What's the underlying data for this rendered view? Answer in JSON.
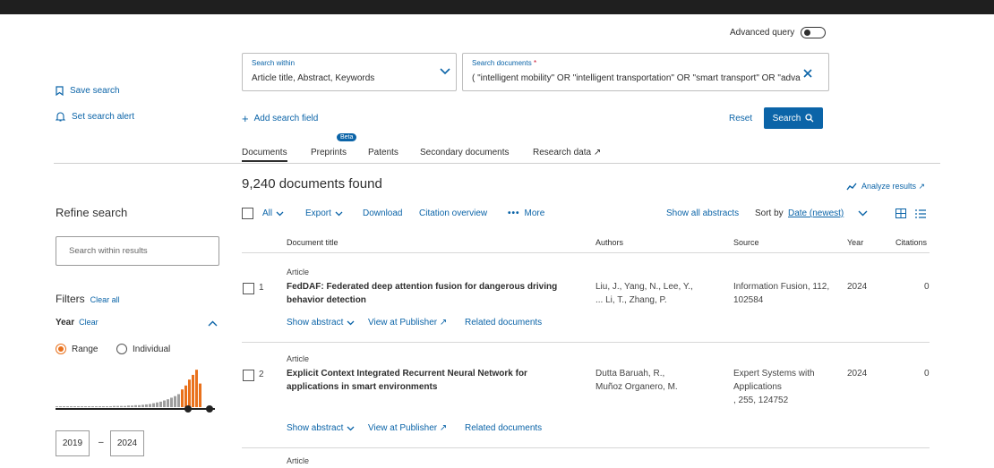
{
  "header": {
    "advanced_query_label": "Advanced query"
  },
  "search": {
    "within_label": "Search within",
    "within_value": "Article title, Abstract, Keywords",
    "docs_label": "Search documents",
    "docs_required": "*",
    "docs_value": "( \"intelligent mobility\" OR \"intelligent transportation\" OR \"smart transport\" OR \"adva",
    "add_field": "Add search field",
    "reset": "Reset",
    "search_button": "Search"
  },
  "left": {
    "save_search": "Save search",
    "set_alert": "Set search alert",
    "refine_title": "Refine search",
    "search_within_placeholder": "Search within results",
    "filters_label": "Filters",
    "clear_all": "Clear all",
    "year_label": "Year",
    "year_clear": "Clear",
    "range_label": "Range",
    "individual_label": "Individual",
    "year_from": "2019",
    "year_dash": "–",
    "year_to": "2024"
  },
  "tabs": [
    {
      "label": "Documents"
    },
    {
      "label": "Preprints"
    },
    {
      "label": "Patents"
    },
    {
      "label": "Secondary documents"
    },
    {
      "label": "Research data ↗"
    }
  ],
  "beta_badge": "Beta",
  "results": {
    "count_text": "9,240 documents found",
    "analyze": "Analyze results ↗",
    "toolbar": {
      "all": "All",
      "export": "Export",
      "download": "Download",
      "citation_overview": "Citation overview",
      "more": "More",
      "show_abstracts": "Show all abstracts",
      "sort_by": "Sort by",
      "sort_value": "Date (newest)"
    },
    "columns": {
      "title": "Document title",
      "authors": "Authors",
      "source": "Source",
      "year": "Year",
      "citations": "Citations"
    },
    "rows": [
      {
        "num": "1",
        "type": "Article",
        "title_line1": "FedDAF: Federated deep attention fusion for dangerous driving",
        "title_line2": "behavior detection",
        "authors_line1": "Liu, J., Yang, N., Lee, Y.,",
        "authors_line2": "... Li, T., Zhang, P.",
        "source_line1": "Information Fusion, 112,",
        "source_line2": "102584",
        "source_line3": "",
        "year": "2024",
        "citations": "0",
        "show_abstract": "Show abstract",
        "view_publisher": "View at Publisher ↗",
        "related": "Related documents"
      },
      {
        "num": "2",
        "type": "Article",
        "title_line1": "Explicit Context Integrated Recurrent Neural Network for",
        "title_line2": "applications in smart environments",
        "authors_line1": "Dutta Baruah, R.,",
        "authors_line2": "Muñoz Organero, M.",
        "source_line1": "Expert Systems with",
        "source_line2": "Applications",
        "source_line3": ", 255, 124752",
        "year": "2024",
        "citations": "0",
        "show_abstract": "Show abstract",
        "view_publisher": "View at Publisher ↗",
        "related": "Related documents"
      },
      {
        "type": "Article"
      }
    ]
  },
  "colors": {
    "accent": "#0b64a8",
    "histogram_selected": "#e9711c",
    "histogram_base": "#9e9e9e"
  },
  "year_histogram": {
    "bars_gray": [
      0.02,
      0.02,
      0.02,
      0.02,
      0.02,
      0.02,
      0.02,
      0.02,
      0.02,
      0.02,
      0.02,
      0.02,
      0.02,
      0.02,
      0.02,
      0.02,
      0.03,
      0.03,
      0.03,
      0.03,
      0.04,
      0.04,
      0.05,
      0.05,
      0.06,
      0.07,
      0.08,
      0.1,
      0.12,
      0.14,
      0.17,
      0.2,
      0.24,
      0.28,
      0.33
    ],
    "bars_orange": [
      0.45,
      0.55,
      0.7,
      0.82,
      0.95,
      0.6
    ]
  }
}
